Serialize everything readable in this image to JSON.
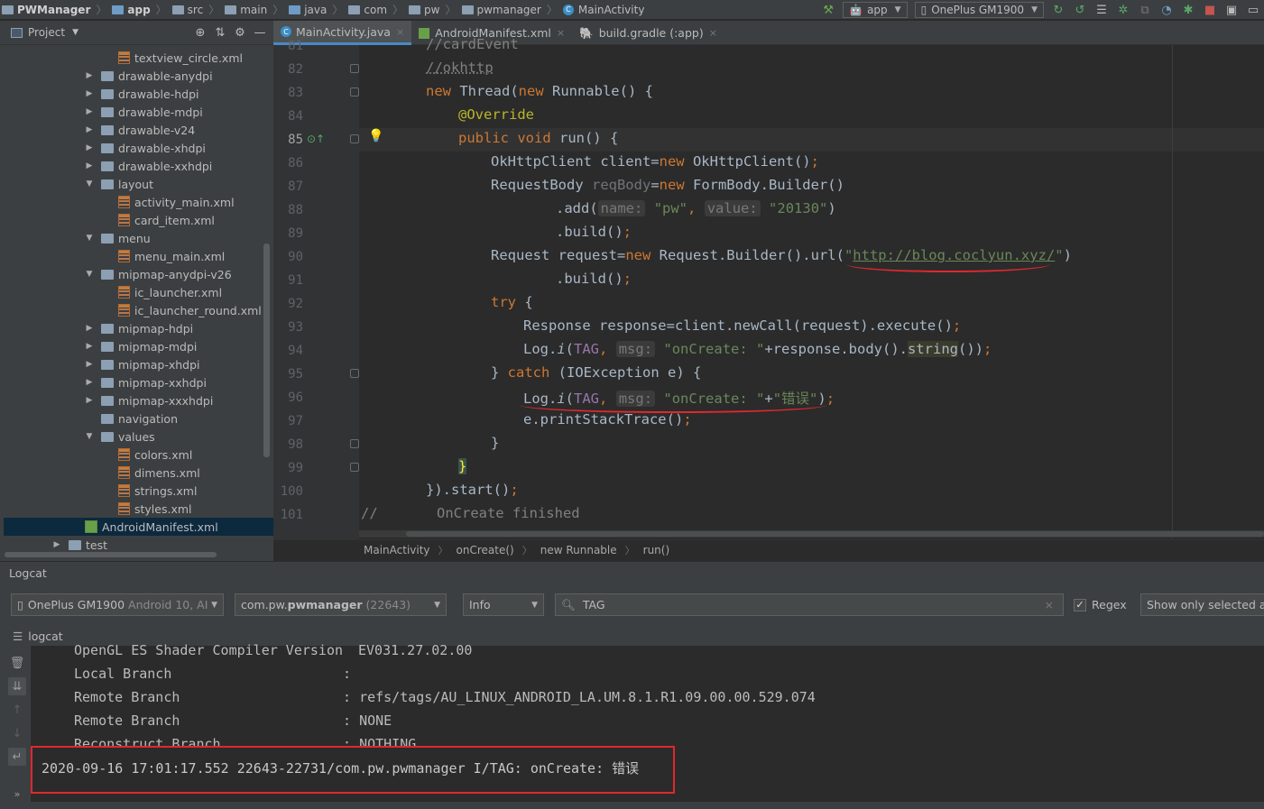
{
  "navbar": {
    "crumbs": [
      {
        "label": "PWManager",
        "bold": true
      },
      {
        "label": "app",
        "bold": true
      },
      {
        "label": "src"
      },
      {
        "label": "main"
      },
      {
        "label": "java"
      },
      {
        "label": "com"
      },
      {
        "label": "pw"
      },
      {
        "label": "pwmanager"
      },
      {
        "label": "MainActivity"
      }
    ],
    "run_config": "app",
    "device": "OnePlus GM1900"
  },
  "project_panel": {
    "title": "Project",
    "tree": [
      {
        "label": "textview_circle.xml",
        "kind": "xml",
        "depth": 3,
        "expand": ""
      },
      {
        "label": "drawable-anydpi",
        "kind": "folder",
        "depth": 2,
        "expand": "▶"
      },
      {
        "label": "drawable-hdpi",
        "kind": "folder",
        "depth": 2,
        "expand": "▶"
      },
      {
        "label": "drawable-mdpi",
        "kind": "folder",
        "depth": 2,
        "expand": "▶"
      },
      {
        "label": "drawable-v24",
        "kind": "folder",
        "depth": 2,
        "expand": "▶"
      },
      {
        "label": "drawable-xhdpi",
        "kind": "folder",
        "depth": 2,
        "expand": "▶"
      },
      {
        "label": "drawable-xxhdpi",
        "kind": "folder",
        "depth": 2,
        "expand": "▶"
      },
      {
        "label": "layout",
        "kind": "folder",
        "depth": 2,
        "expand": "▼"
      },
      {
        "label": "activity_main.xml",
        "kind": "xml",
        "depth": 3,
        "expand": ""
      },
      {
        "label": "card_item.xml",
        "kind": "xml",
        "depth": 3,
        "expand": ""
      },
      {
        "label": "menu",
        "kind": "folder",
        "depth": 2,
        "expand": "▼"
      },
      {
        "label": "menu_main.xml",
        "kind": "xml",
        "depth": 3,
        "expand": ""
      },
      {
        "label": "mipmap-anydpi-v26",
        "kind": "folder",
        "depth": 2,
        "expand": "▼"
      },
      {
        "label": "ic_launcher.xml",
        "kind": "xml",
        "depth": 3,
        "expand": ""
      },
      {
        "label": "ic_launcher_round.xml",
        "kind": "xml",
        "depth": 3,
        "expand": ""
      },
      {
        "label": "mipmap-hdpi",
        "kind": "folder",
        "depth": 2,
        "expand": "▶"
      },
      {
        "label": "mipmap-mdpi",
        "kind": "folder",
        "depth": 2,
        "expand": "▶"
      },
      {
        "label": "mipmap-xhdpi",
        "kind": "folder",
        "depth": 2,
        "expand": "▶"
      },
      {
        "label": "mipmap-xxhdpi",
        "kind": "folder",
        "depth": 2,
        "expand": "▶"
      },
      {
        "label": "mipmap-xxxhdpi",
        "kind": "folder",
        "depth": 2,
        "expand": "▶"
      },
      {
        "label": "navigation",
        "kind": "folder",
        "depth": 2,
        "expand": ""
      },
      {
        "label": "values",
        "kind": "folder",
        "depth": 2,
        "expand": "▼"
      },
      {
        "label": "colors.xml",
        "kind": "xml",
        "depth": 3,
        "expand": ""
      },
      {
        "label": "dimens.xml",
        "kind": "xml",
        "depth": 3,
        "expand": ""
      },
      {
        "label": "strings.xml",
        "kind": "xml",
        "depth": 3,
        "expand": ""
      },
      {
        "label": "styles.xml",
        "kind": "xml",
        "depth": 3,
        "expand": ""
      },
      {
        "label": "AndroidManifest.xml",
        "kind": "manifest",
        "depth": 1,
        "expand": "",
        "selected": true
      },
      {
        "label": "test",
        "kind": "folder",
        "depth": 0,
        "expand": "▶"
      }
    ]
  },
  "tabs": [
    {
      "label": "MainActivity.java",
      "active": true
    },
    {
      "label": "AndroidManifest.xml",
      "active": false
    },
    {
      "label": "build.gradle (:app)",
      "active": false
    }
  ],
  "editor": {
    "line_numbers": [
      "82",
      "83",
      "84",
      "85",
      "86",
      "87",
      "88",
      "89",
      "90",
      "91",
      "92",
      "93",
      "94",
      "95",
      "96",
      "97",
      "98",
      "99",
      "100",
      "101"
    ],
    "code": {
      "l82_comment": "//okhttp",
      "l83_new": "new ",
      "l83_thread": "Thread(",
      "l83_new2": "new ",
      "l83_rest": "Runnable() {",
      "l84_ann": "@Override",
      "l85_kw": "public void ",
      "l85_rest": "run() {",
      "l86_a": "OkHttpClient client=",
      "l86_new": "new ",
      "l86_b": "OkHttpClient()",
      "l86_semi": ";",
      "l87_a": "RequestBody ",
      "l87_var": "reqBody",
      "l87_eq": "=",
      "l87_new": "new ",
      "l87_b": "FormBody.Builder()",
      "l88_a": ".add(",
      "l88_hint1": "name:",
      "l88_s1": "\"pw\"",
      "l88_comma": ",",
      "l88_hint2": "value:",
      "l88_s2": "\"20130\"",
      "l88_b": ")",
      "l89_a": ".build()",
      "l89_semi": ";",
      "l90_a": "Request request=",
      "l90_new": "new ",
      "l90_b": "Request.Builder().url(",
      "l90_q1": "\"",
      "l90_url": "http://blog.coclyun.xyz/",
      "l90_q2": "\"",
      "l90_c": ")",
      "l91_a": ".build()",
      "l91_semi": ";",
      "l92_kw": "try ",
      "l92_b": "{",
      "l93_a": "Response response=client.newCall(request).execute()",
      "l93_semi": ";",
      "l94_a": "Log.",
      "l94_i": "i",
      "l94_b": "(",
      "l94_tag": "TAG",
      "l94_comma": ",",
      "l94_hint": "msg:",
      "l94_s": "\"onCreate: \"",
      "l94_c": "+response.body().",
      "l94_str": "string",
      "l94_d": "())",
      "l94_semi": ";",
      "l95_a": "} ",
      "l95_kw": "catch ",
      "l95_b": "(IOException e) {",
      "l96_a": "Log.",
      "l96_i": "i",
      "l96_b": "(",
      "l96_tag": "TAG",
      "l96_comma": ",",
      "l96_hint": "msg:",
      "l96_s1": "\"onCreate: \"",
      "l96_plus": "+",
      "l96_s2": "\"错误\"",
      "l96_c": ")",
      "l96_semi": ";",
      "l97_a": "e.printStackTrace()",
      "l97_semi": ";",
      "l98_a": "}",
      "l99_a": "}",
      "l100_a": "}).start()",
      "l100_semi": ";",
      "l101_a": "//       OnCreate finished"
    }
  },
  "editor_breadcrumb": [
    "MainActivity",
    "onCreate()",
    "new Runnable",
    "run()"
  ],
  "logcat": {
    "title": "Logcat",
    "device": "OnePlus GM1900",
    "device_os": "Android 10, AI",
    "process_pkg": "com.pw.",
    "process_pkg_bold": "pwmanager",
    "process_pid": "(22643)",
    "level": "Info",
    "filter": "TAG",
    "regex_label": "Regex",
    "regex_checked": true,
    "show_only": "Show only selected ap",
    "sub_title": "logcat",
    "lines": [
      {
        "key": "OpenGL ES Shader Compiler Version",
        "value": "EV031.27.02.00"
      },
      {
        "key": "Local Branch",
        "value": ""
      },
      {
        "key": "Remote Branch",
        "value": "refs/tags/AU_LINUX_ANDROID_LA.UM.8.1.R1.09.00.00.529.074"
      },
      {
        "key": "Remote Branch",
        "value": "NONE"
      },
      {
        "key": "Reconstruct Branch",
        "value": "NOTHING"
      }
    ],
    "highlight_line": "2020-09-16 17:01:17.552 22643-22731/com.pw.pwmanager I/TAG: onCreate: 错误"
  },
  "colors": {
    "keyword": "#cc7832",
    "string": "#6a8759",
    "annotation": "#bbb529",
    "comment": "#808080",
    "annotation_red": "#e0282e"
  }
}
